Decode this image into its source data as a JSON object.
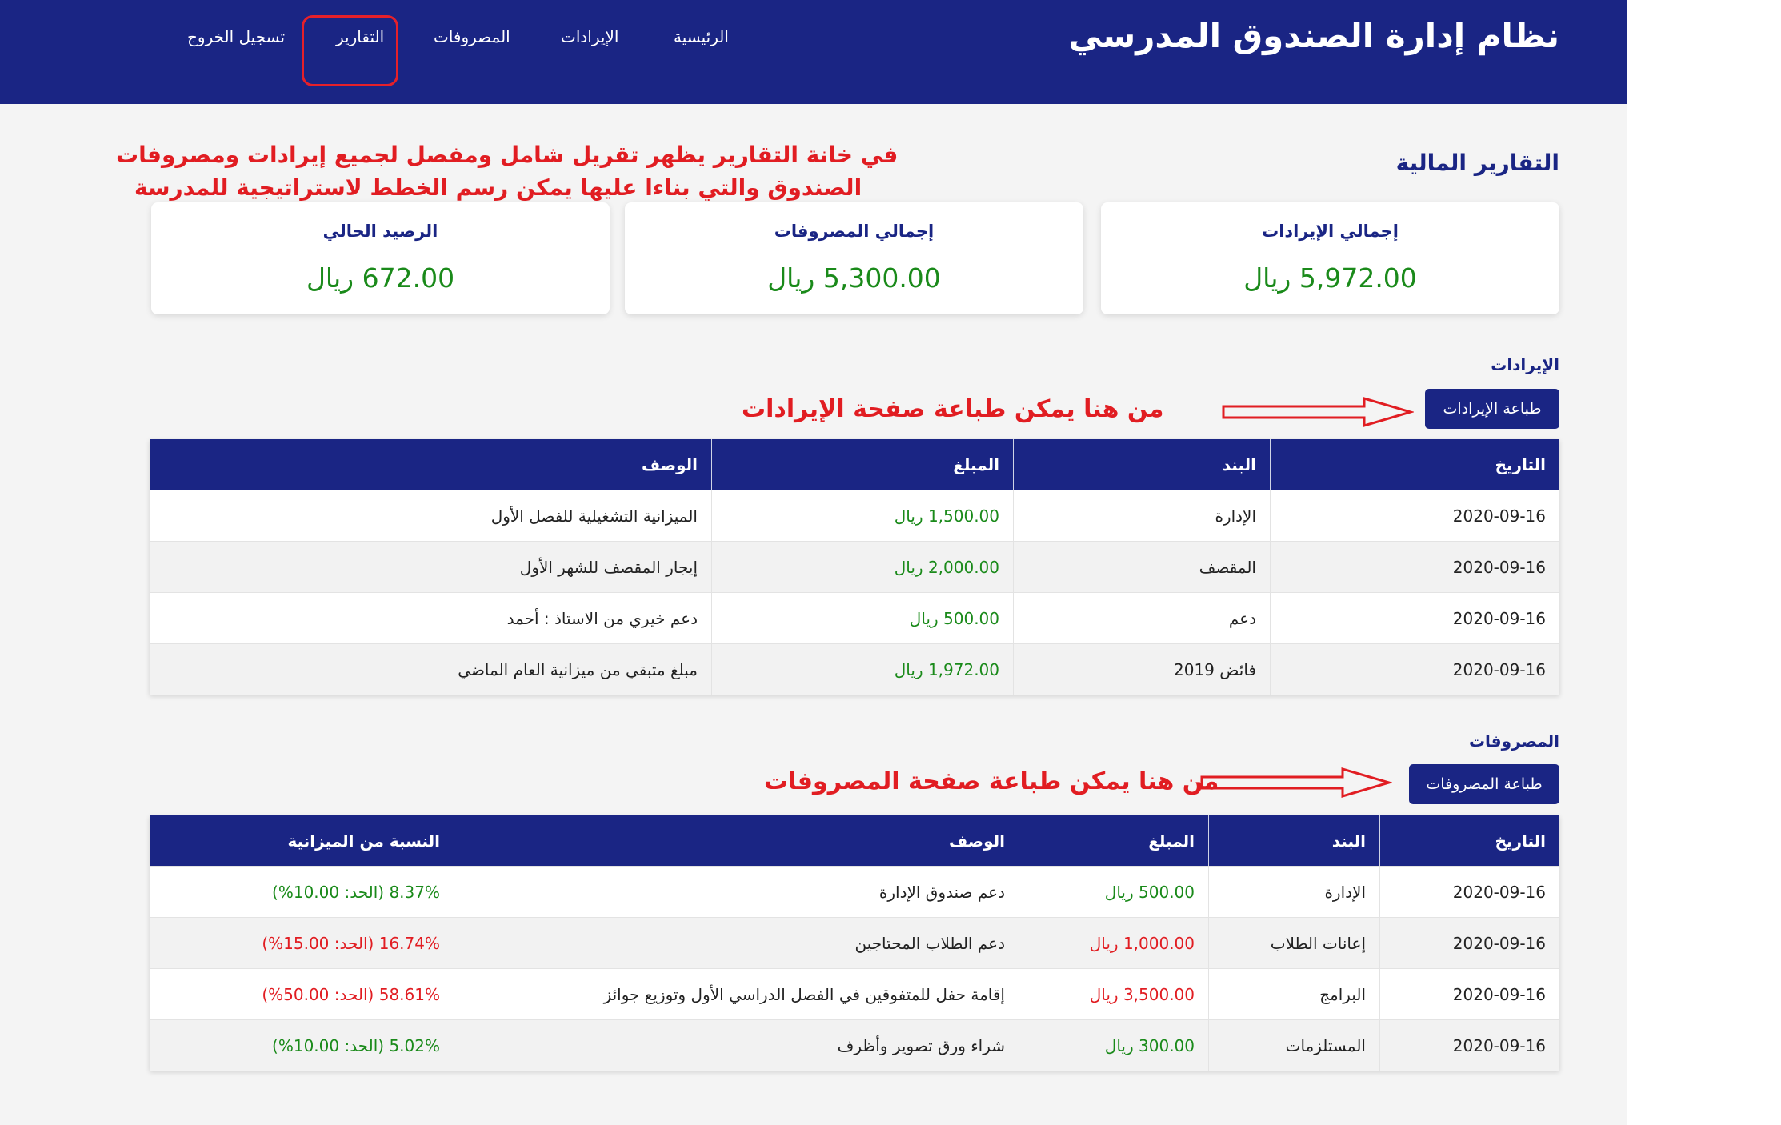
{
  "header": {
    "brand": "نظام إدارة الصندوق المدرسي",
    "nav": [
      {
        "label": "الرئيسية"
      },
      {
        "label": "الإيرادات"
      },
      {
        "label": "المصروفات"
      },
      {
        "label": "التقارير"
      },
      {
        "label": "تسجيل الخروج"
      }
    ],
    "active_nav": "التقارير",
    "colors": {
      "bar": "#1a2584",
      "highlight": "#e5202a"
    }
  },
  "annotations": {
    "reports_line1": "في خانة التقارير يظهر تقريل شامل ومفصل لجميع إيرادات ومصروفات",
    "reports_line2": "الصندوق والتي بناءا عليها يمكن رسم الخطط لاستراتيجية للمدرسة",
    "print_revenue": "من هنا يمكن طباعة صفحة الإيرادات",
    "print_expenses": "من هنا يمكن طباعة صفحة المصروفات",
    "color": "#e11d22"
  },
  "page": {
    "title": "التقارير المالية"
  },
  "summary": [
    {
      "title": "إجمالي الإيرادات",
      "value": "5,972.00 ريال"
    },
    {
      "title": "إجمالي المصروفات",
      "value": "5,300.00 ريال"
    },
    {
      "title": "الرصيد الحالي",
      "value": "672.00 ريال"
    }
  ],
  "revenue": {
    "title": "الإيرادات",
    "print_label": "طباعة الإيرادات",
    "columns": [
      "التاريخ",
      "البند",
      "المبلغ",
      "الوصف"
    ],
    "rows": [
      {
        "date": "2020-09-16",
        "item": "الإدارة",
        "amount": "1,500.00 ريال",
        "desc": "الميزانية التشغيلية للفصل الأول"
      },
      {
        "date": "2020-09-16",
        "item": "المقصف",
        "amount": "2,000.00 ريال",
        "desc": "إيجار المقصف للشهر الأول"
      },
      {
        "date": "2020-09-16",
        "item": "دعم",
        "amount": "500.00 ريال",
        "desc": "دعم خيري من الاستاذ : أحمد"
      },
      {
        "date": "2020-09-16",
        "item": "فائض 2019",
        "amount": "1,972.00 ريال",
        "desc": "مبلغ متبقي من ميزانية العام الماضي"
      }
    ]
  },
  "expenses": {
    "title": "المصروفات",
    "print_label": "طباعة المصروفات",
    "columns": [
      "التاريخ",
      "البند",
      "المبلغ",
      "الوصف",
      "النسبة من الميزانية"
    ],
    "rows": [
      {
        "date": "2020-09-16",
        "item": "الإدارة",
        "amount": "500.00 ريال",
        "desc": "دعم صندوق الإدارة",
        "ratio": "8.37% (الحد: 10.00%)",
        "status": "ok"
      },
      {
        "date": "2020-09-16",
        "item": "إعانات الطلاب",
        "amount": "1,000.00 ريال",
        "desc": "دعم الطلاب المحتاجين",
        "ratio": "16.74% (الحد: 15.00%)",
        "status": "over"
      },
      {
        "date": "2020-09-16",
        "item": "البرامج",
        "amount": "3,500.00 ريال",
        "desc": "إقامة حفل للمتفوقين في الفصل الدراسي الأول وتوزيع جوائز",
        "ratio": "58.61% (الحد: 50.00%)",
        "status": "over"
      },
      {
        "date": "2020-09-16",
        "item": "المستلزمات",
        "amount": "300.00 ريال",
        "desc": "شراء ورق تصوير وأظرف",
        "ratio": "5.02% (الحد: 10.00%)",
        "status": "ok"
      }
    ]
  }
}
